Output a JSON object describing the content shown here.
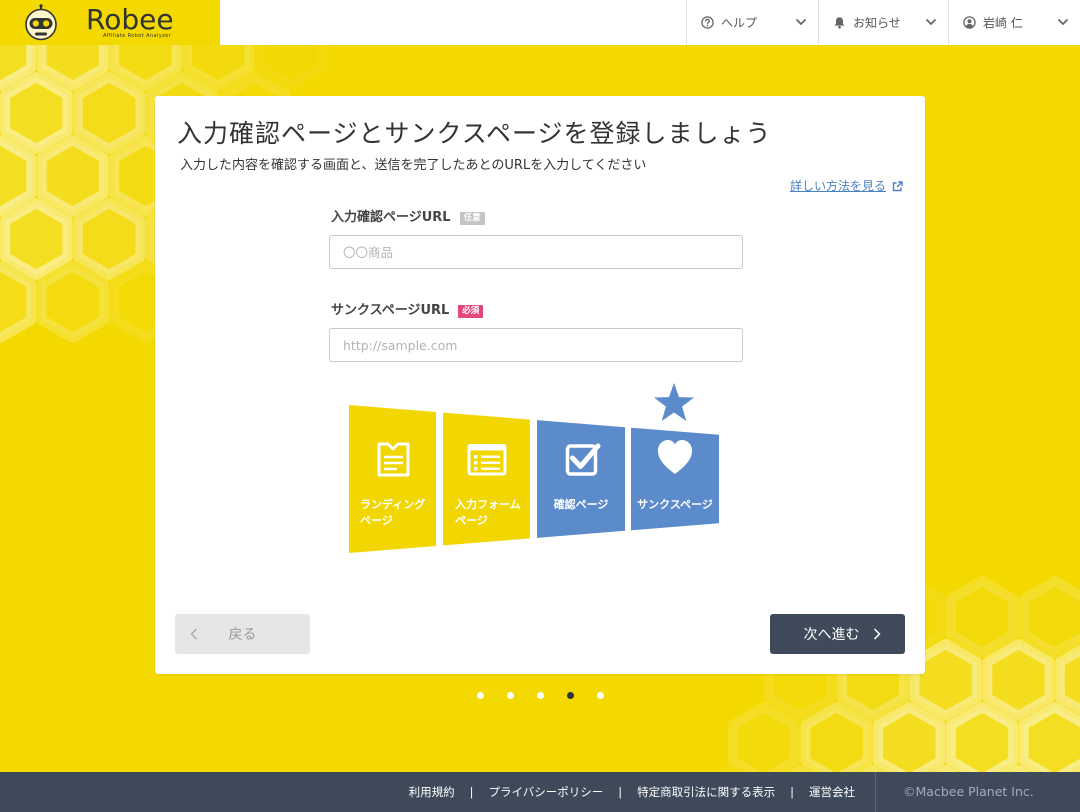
{
  "header": {
    "logo": {
      "name": "Robee",
      "tagline": "Affiliate Robot Analyzer",
      "icon": "robot-icon"
    },
    "menus": [
      {
        "icon": "help-circle-icon",
        "label": "ヘルプ"
      },
      {
        "icon": "bell-icon",
        "label": "お知らせ"
      },
      {
        "icon": "user-circle-icon",
        "label": "岩崎 仁"
      }
    ]
  },
  "card": {
    "title": "入力確認ページとサンクスページを登録しましょう",
    "description": "入力した内容を確認する画面と、送信を完了したあとのURLを入力してください",
    "help_link": {
      "label": "詳しい方法を見る",
      "icon": "external-link-icon"
    },
    "fields": [
      {
        "label": "入力確認ページURL",
        "badge": "任意",
        "badge_color": "#c4c4c4",
        "placeholder": "〇〇商品",
        "value": ""
      },
      {
        "label": "サンクスページURL",
        "badge": "必須",
        "badge_color": "#e2487c",
        "placeholder": "http://sample.com",
        "value": ""
      }
    ],
    "steps": [
      {
        "lines": [
          "ランディング",
          "ページ"
        ],
        "icon": "document-icon",
        "color": "#f2d600"
      },
      {
        "lines": [
          "入力フォーム",
          "ページ"
        ],
        "icon": "form-icon",
        "color": "#f2d600"
      },
      {
        "lines": [
          "確認ページ"
        ],
        "icon": "checkbox-icon",
        "color": "#5b8bcb"
      },
      {
        "lines": [
          "サンクスページ"
        ],
        "icon": "heart-icon",
        "color": "#5b8bcb",
        "starred": true
      }
    ],
    "back_button": {
      "label": "戻る",
      "enabled": false
    },
    "next_button": {
      "label": "次へ進む",
      "enabled": true
    }
  },
  "pagination": {
    "total": 5,
    "current": 4
  },
  "footer": {
    "links": [
      "利用規約",
      "プライバシーポリシー",
      "特定商取引法に関する表示",
      "運営会社"
    ],
    "separator": "|",
    "copyright": "©Macbee Planet Inc."
  },
  "colors": {
    "brand_yellow": "#f3d900",
    "accent_blue": "#5b8bcb",
    "primary_button": "#3f4b5b",
    "footer_bg": "#3e4a5a",
    "link": "#4a80c4"
  }
}
